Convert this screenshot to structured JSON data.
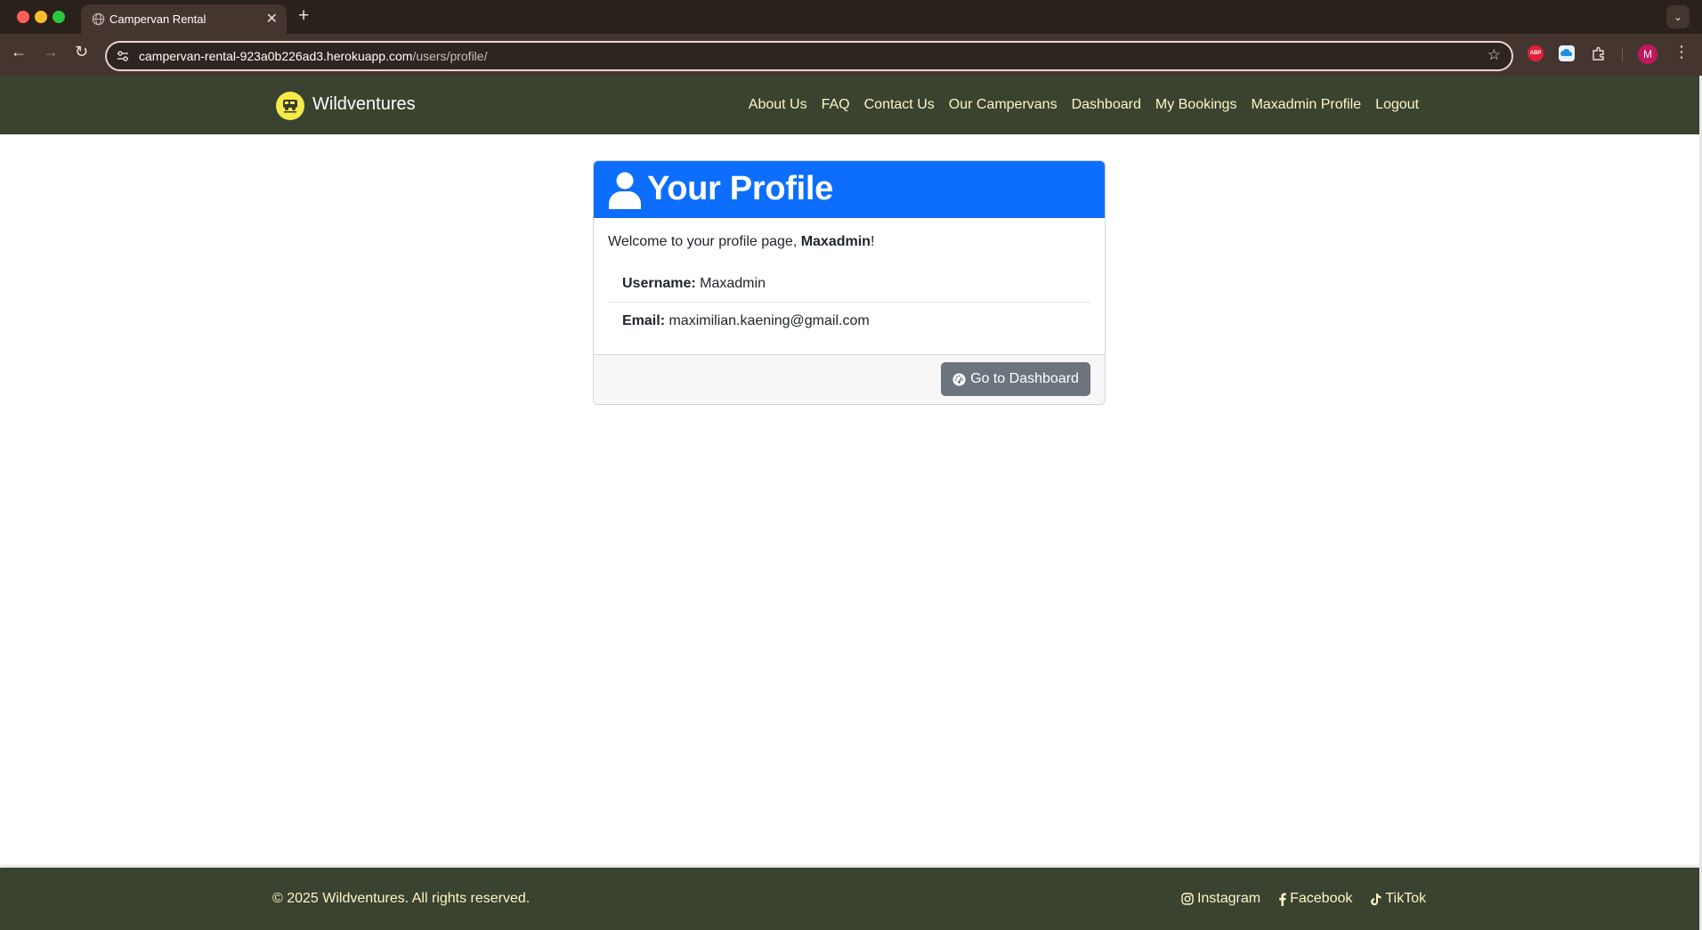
{
  "browser": {
    "tab_title": "Campervan Rental",
    "tab_close": "✕",
    "new_tab": "+",
    "url_host": "campervan-rental-923a0b226ad3.herokuapp.com",
    "url_path": "/users/profile/",
    "profile_initial": "M",
    "abp_label": "ABP"
  },
  "nav": {
    "brand": "Wildventures",
    "links": [
      "About Us",
      "FAQ",
      "Contact Us",
      "Our Campervans",
      "Dashboard",
      "My Bookings",
      "Maxadmin Profile",
      "Logout"
    ]
  },
  "profile": {
    "title": "Your Profile",
    "welcome_prefix": "Welcome to your profile page, ",
    "welcome_name": "Maxadmin",
    "welcome_suffix": "!",
    "username_label": "Username:",
    "username_value": "Maxadmin",
    "email_label": "Email:",
    "email_value": "maximilian.kaening@gmail.com",
    "dashboard_button": "Go to Dashboard"
  },
  "footer": {
    "copyright": "© 2025 Wildventures. All rights reserved.",
    "social": [
      "Instagram",
      "Facebook",
      "TikTok"
    ]
  },
  "colors": {
    "header_blue": "#0d6efd",
    "nav_bg": "#3a4230",
    "nav_text": "#fff6c7",
    "button_gray": "#6c757d"
  }
}
